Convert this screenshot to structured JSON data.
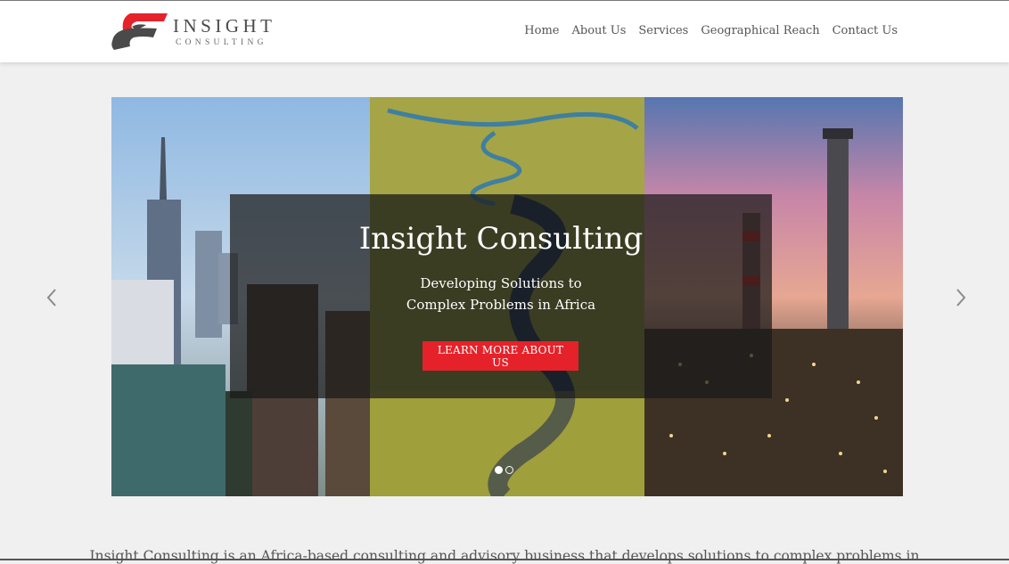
{
  "brand": {
    "name": "INSIGHT",
    "subtitle": "CONSULTING",
    "colors": {
      "red": "#e5222a",
      "dark": "#4a4a4a"
    }
  },
  "nav": {
    "items": [
      {
        "label": "Home"
      },
      {
        "label": "About Us"
      },
      {
        "label": "Services"
      },
      {
        "label": "Geographical Reach"
      },
      {
        "label": "Contact Us"
      }
    ]
  },
  "hero": {
    "title": "Insight Consulting",
    "subtitle_line1": "Developing Solutions to",
    "subtitle_line2": "Complex Problems in Africa",
    "cta_label": "LEARN MORE ABOUT US",
    "cta_color": "#e5222a",
    "panels": [
      "city-skyline-image",
      "river-landscape-image",
      "refinery-image"
    ],
    "slide_count": 2,
    "active_slide": 1
  },
  "icons": {
    "prev": "chevron-left-icon",
    "next": "chevron-right-icon"
  },
  "intro": {
    "text": "Insight Consulting is an Africa-based consulting and advisory business that develops solutions to complex problems in"
  }
}
